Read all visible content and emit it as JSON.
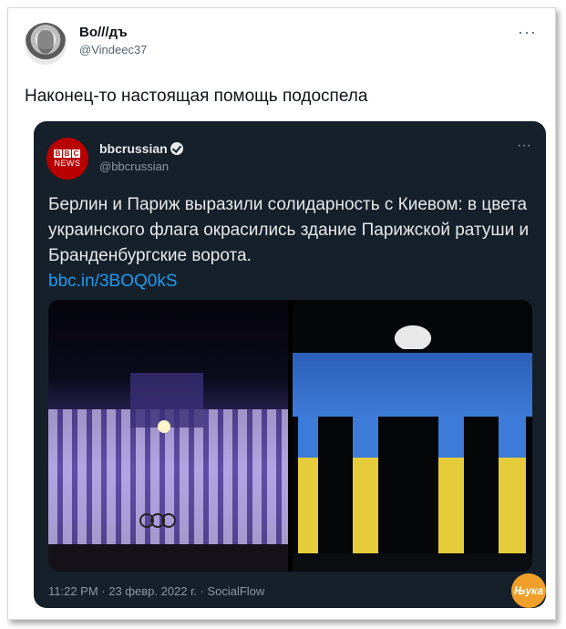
{
  "tweet": {
    "author_name": "Во///дъ",
    "author_handle": "@Vindeec37",
    "more_label": "···",
    "text": "Наконец-то настоящая помощь подоспела"
  },
  "quoted": {
    "logo_letters": [
      "B",
      "B",
      "C"
    ],
    "logo_sub": "NEWS",
    "author_name": "bbcrussian",
    "author_handle": "@bbcrussian",
    "more_label": "···",
    "text": "Берлин и Париж выразили солидарность с Киевом: в цвета украинского флага окрасились здание Парижской ратуши и Бранденбургские ворота.",
    "link": "bbc.in/3BOQ0kS",
    "timestamp": "11:22 PM · 23 февр. 2022 г. · SocialFlow"
  },
  "colors": {
    "card_bg": "#15202b",
    "link": "#1d9bf0",
    "flag_blue": "#3d7bd8",
    "flag_yellow": "#e6cc3a"
  },
  "watermark": "Њука"
}
